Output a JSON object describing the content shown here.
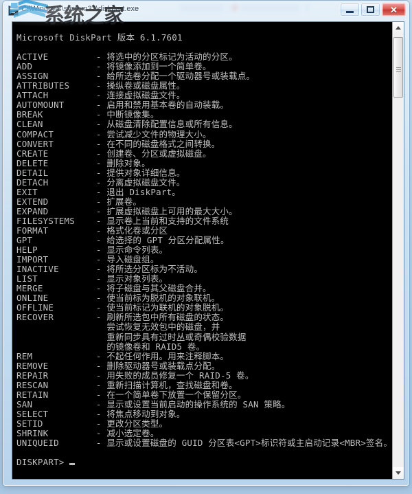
{
  "window": {
    "title": "C:\\Windows\\system32\\diskpart.exe",
    "icon_name": "console-window-icon",
    "controls": {
      "minimize_label": "–",
      "maximize_label": "□",
      "close_label": "✕"
    }
  },
  "watermark": {
    "text": "系统之家",
    "logo_name": "house-logo"
  },
  "console": {
    "colors": {
      "background": "#000000",
      "foreground": "#c0c0c0"
    },
    "header": "Microsoft DiskPart 版本 6.1.7601",
    "prompt": "DISKPART>",
    "commands": [
      {
        "name": "ACTIVE",
        "dash": "-",
        "desc": "将选中的分区标记为活动的分区。"
      },
      {
        "name": "ADD",
        "dash": "-",
        "desc": "将镜像添加到一个简单卷。"
      },
      {
        "name": "ASSIGN",
        "dash": "-",
        "desc": "给所选卷分配一个驱动器号或装载点。"
      },
      {
        "name": "ATTRIBUTES",
        "dash": "-",
        "desc": "操纵卷或磁盘属性。"
      },
      {
        "name": "ATTACH",
        "dash": "-",
        "desc": "连接虚拟磁盘文件。"
      },
      {
        "name": "AUTOMOUNT",
        "dash": "-",
        "desc": "启用和禁用基本卷的自动装载。"
      },
      {
        "name": "BREAK",
        "dash": "-",
        "desc": "中断镜像集。"
      },
      {
        "name": "CLEAN",
        "dash": "-",
        "desc": "从磁盘清除配置信息或所有信息。"
      },
      {
        "name": "COMPACT",
        "dash": "-",
        "desc": "尝试减少文件的物理大小。"
      },
      {
        "name": "CONVERT",
        "dash": "-",
        "desc": "在不同的磁盘格式之间转换。"
      },
      {
        "name": "CREATE",
        "dash": "-",
        "desc": "创建卷、分区或虚拟磁盘。"
      },
      {
        "name": "DELETE",
        "dash": "-",
        "desc": "删除对象。"
      },
      {
        "name": "DETAIL",
        "dash": "-",
        "desc": "提供对象详细信息。"
      },
      {
        "name": "DETACH",
        "dash": "-",
        "desc": "分离虚拟磁盘文件。"
      },
      {
        "name": "EXIT",
        "dash": "-",
        "desc": "退出 DiskPart。"
      },
      {
        "name": "EXTEND",
        "dash": "-",
        "desc": "扩展卷。"
      },
      {
        "name": "EXPAND",
        "dash": "-",
        "desc": "扩展虚拟磁盘上可用的最大大小。"
      },
      {
        "name": "FILESYSTEMS",
        "dash": "-",
        "desc": "显示卷上当前和支持的文件系统"
      },
      {
        "name": "FORMAT",
        "dash": "-",
        "desc": "格式化卷或分区"
      },
      {
        "name": "GPT",
        "dash": "-",
        "desc": "给选择的 GPT 分区分配属性。"
      },
      {
        "name": "HELP",
        "dash": "-",
        "desc": "显示命令列表。"
      },
      {
        "name": "IMPORT",
        "dash": "-",
        "desc": "导入磁盘组。"
      },
      {
        "name": "INACTIVE",
        "dash": "-",
        "desc": "将所选分区标为不活动。"
      },
      {
        "name": "LIST",
        "dash": "-",
        "desc": "显示对象列表。"
      },
      {
        "name": "MERGE",
        "dash": "-",
        "desc": "将子磁盘与其父磁盘合并。"
      },
      {
        "name": "ONLINE",
        "dash": "-",
        "desc": "使当前标为脱机的对象联机。"
      },
      {
        "name": "OFFLINE",
        "dash": "-",
        "desc": "使当前标记为联机的对象脱机。"
      },
      {
        "name": "RECOVER",
        "dash": "-",
        "desc": "刷新所选包中所有磁盘的状态。",
        "continuation": [
          "尝试恢复无效包中的磁盘，并",
          "重新同步具有过时丛或奇偶校验数据",
          "的镜像卷和 RAID5 卷。"
        ]
      },
      {
        "name": "REM",
        "dash": "-",
        "desc": "不起任何作用。用来注释脚本。"
      },
      {
        "name": "REMOVE",
        "dash": "-",
        "desc": "删除驱动器号或装载点分配。"
      },
      {
        "name": "REPAIR",
        "dash": "-",
        "desc": "用失败的成员修复一个 RAID-5 卷。"
      },
      {
        "name": "RESCAN",
        "dash": "-",
        "desc": "重新扫描计算机，查找磁盘和卷。"
      },
      {
        "name": "RETAIN",
        "dash": "-",
        "desc": "在一个简单卷下放置一个保留分区。"
      },
      {
        "name": "SAN",
        "dash": "-",
        "desc": "显示或设置当前启动的操作系统的 SAN 策略。"
      },
      {
        "name": "SELECT",
        "dash": "-",
        "desc": "将焦点移动到对象。"
      },
      {
        "name": "SETID",
        "dash": "-",
        "desc": "更改分区类型。"
      },
      {
        "name": "SHRINK",
        "dash": "-",
        "desc": "减小选定卷。"
      },
      {
        "name": "UNIQUEID",
        "dash": "-",
        "desc": "显示或设置磁盘的 GUID 分区表<GPT>标识符或主启动记录<MBR>签名。"
      }
    ]
  },
  "scrollbar": {
    "up_arrow_name": "scroll-up-arrow",
    "down_arrow_name": "scroll-down-arrow"
  }
}
